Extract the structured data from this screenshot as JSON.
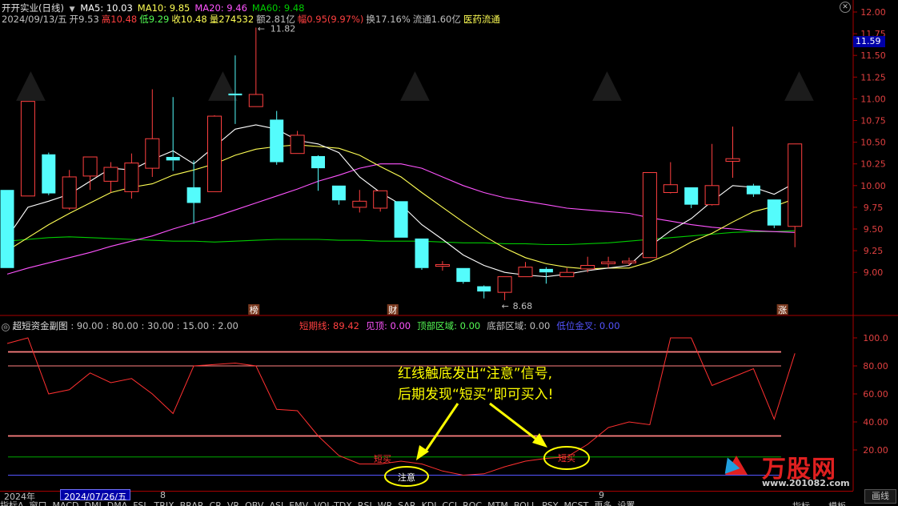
{
  "colors": {
    "background": "#000000",
    "up": "#ff4040",
    "down": "#54fcfc",
    "ma5": "#ffffff",
    "ma10": "#ffff54",
    "ma20": "#ff54ff",
    "ma60": "#00cc00",
    "axis_border": "#a80000",
    "price_tag": "#0000a8"
  },
  "title": "开开实业(日线)",
  "ma_legend": [
    {
      "label": "MA5: 10.03",
      "color": "#ffffff"
    },
    {
      "label": "MA10: 9.85",
      "color": "#ffff54"
    },
    {
      "label": "MA20: 9.46",
      "color": "#ff54ff"
    },
    {
      "label": "MA60: 9.48",
      "color": "#00cc00"
    }
  ],
  "info_row": [
    {
      "text": "2024/09/13/五",
      "color": "#c0c0c0"
    },
    {
      "text": "开9.53",
      "color": "#c0c0c0"
    },
    {
      "text": "高10.48",
      "color": "#ff4040"
    },
    {
      "text": "低9.29",
      "color": "#54fc54"
    },
    {
      "text": "收10.48",
      "color": "#ffff54"
    },
    {
      "text": "量274532",
      "color": "#ffff54"
    },
    {
      "text": "额2.81亿",
      "color": "#c0c0c0"
    },
    {
      "text": "幅0.95(9.97%)",
      "color": "#ff4040"
    },
    {
      "text": "换17.16%",
      "color": "#c0c0c0"
    },
    {
      "text": "流通1.60亿",
      "color": "#c0c0c0"
    },
    {
      "text": "医药流通",
      "color": "#ffff54"
    }
  ],
  "price_axis": {
    "ticks": [
      "12.00",
      "11.75",
      "11.50",
      "11.25",
      "11.00",
      "10.75",
      "10.50",
      "10.25",
      "10.00",
      "9.75",
      "9.50",
      "9.25",
      "9.00"
    ],
    "current_price": "11.59"
  },
  "annotations": {
    "high": "11.82",
    "low": "8.68",
    "marker_bang": "榜",
    "marker_cai": "财",
    "marker_zhang": "涨"
  },
  "candles": [
    {
      "o": 9.95,
      "c": 9.05,
      "h": 9.95,
      "l": 9.05
    },
    {
      "o": 9.88,
      "c": 10.97,
      "h": 10.97,
      "l": 9.88
    },
    {
      "o": 10.36,
      "c": 9.91,
      "h": 10.38,
      "l": 9.89
    },
    {
      "o": 9.74,
      "c": 10.1,
      "h": 10.18,
      "l": 9.72
    },
    {
      "o": 10.11,
      "c": 10.33,
      "h": 10.33,
      "l": 9.95
    },
    {
      "o": 10.05,
      "c": 10.21,
      "h": 10.27,
      "l": 9.92
    },
    {
      "o": 9.93,
      "c": 10.26,
      "h": 10.37,
      "l": 9.85
    },
    {
      "o": 10.2,
      "c": 10.54,
      "h": 11.11,
      "l": 10.1
    },
    {
      "o": 10.33,
      "c": 10.29,
      "h": 11.02,
      "l": 10.17
    },
    {
      "o": 9.98,
      "c": 9.8,
      "h": 10.29,
      "l": 9.56
    },
    {
      "o": 9.93,
      "c": 10.8,
      "h": 10.81,
      "l": 9.93
    },
    {
      "o": 11.06,
      "c": 11.04,
      "h": 11.5,
      "l": 10.71
    },
    {
      "o": 10.91,
      "c": 11.05,
      "h": 11.82,
      "l": 10.91
    },
    {
      "o": 10.76,
      "c": 10.27,
      "h": 10.86,
      "l": 10.24
    },
    {
      "o": 10.37,
      "c": 10.58,
      "h": 10.63,
      "l": 10.37
    },
    {
      "o": 10.34,
      "c": 10.2,
      "h": 10.35,
      "l": 9.94
    },
    {
      "o": 10.0,
      "c": 9.83,
      "h": 10.0,
      "l": 9.78
    },
    {
      "o": 9.75,
      "c": 9.82,
      "h": 9.95,
      "l": 9.69
    },
    {
      "o": 9.74,
      "c": 9.94,
      "h": 9.94,
      "l": 9.7
    },
    {
      "o": 9.82,
      "c": 9.4,
      "h": 9.82,
      "l": 9.4
    },
    {
      "o": 9.39,
      "c": 9.05,
      "h": 9.39,
      "l": 9.03
    },
    {
      "o": 9.07,
      "c": 9.09,
      "h": 9.13,
      "l": 9.02
    },
    {
      "o": 9.05,
      "c": 8.89,
      "h": 9.05,
      "l": 8.87
    },
    {
      "o": 8.84,
      "c": 8.78,
      "h": 8.85,
      "l": 8.7
    },
    {
      "o": 8.77,
      "c": 8.95,
      "h": 8.95,
      "l": 8.68
    },
    {
      "o": 8.95,
      "c": 9.06,
      "h": 9.12,
      "l": 8.96
    },
    {
      "o": 9.04,
      "c": 9.0,
      "h": 9.06,
      "l": 8.87
    },
    {
      "o": 8.95,
      "c": 9.0,
      "h": 9.05,
      "l": 8.95
    },
    {
      "o": 9.04,
      "c": 9.08,
      "h": 9.18,
      "l": 9.0
    },
    {
      "o": 9.1,
      "c": 9.12,
      "h": 9.18,
      "l": 9.05
    },
    {
      "o": 9.11,
      "c": 9.13,
      "h": 9.17,
      "l": 9.08
    },
    {
      "o": 9.17,
      "c": 10.15,
      "h": 10.15,
      "l": 9.17
    },
    {
      "o": 9.92,
      "c": 10.01,
      "h": 10.27,
      "l": 9.91
    },
    {
      "o": 9.98,
      "c": 9.78,
      "h": 9.98,
      "l": 9.74
    },
    {
      "o": 9.78,
      "c": 10.0,
      "h": 10.48,
      "l": 9.77
    },
    {
      "o": 10.28,
      "c": 10.31,
      "h": 10.68,
      "l": 10.09
    },
    {
      "o": 10.0,
      "c": 9.9,
      "h": 10.02,
      "l": 9.87
    },
    {
      "o": 9.84,
      "c": 9.54,
      "h": 9.84,
      "l": 9.51
    },
    {
      "o": 9.53,
      "c": 10.48,
      "h": 10.48,
      "l": 9.29
    }
  ],
  "ma_series": {
    "ma5": [
      9.4,
      9.75,
      9.82,
      9.9,
      10.05,
      10.2,
      10.18,
      10.3,
      10.4,
      10.25,
      10.45,
      10.65,
      10.7,
      10.65,
      10.52,
      10.48,
      10.38,
      10.1,
      9.92,
      9.78,
      9.55,
      9.38,
      9.2,
      9.08,
      9.0,
      8.97,
      8.95,
      8.98,
      9.02,
      9.05,
      9.08,
      9.3,
      9.48,
      9.62,
      9.82,
      10.0,
      9.98,
      9.9,
      10.03
    ],
    "ma10": [
      9.25,
      9.4,
      9.55,
      9.68,
      9.8,
      9.92,
      9.98,
      10.02,
      10.12,
      10.18,
      10.25,
      10.35,
      10.42,
      10.45,
      10.47,
      10.45,
      10.43,
      10.35,
      10.22,
      10.1,
      9.92,
      9.75,
      9.58,
      9.42,
      9.28,
      9.17,
      9.1,
      9.06,
      9.04,
      9.05,
      9.05,
      9.12,
      9.22,
      9.35,
      9.45,
      9.58,
      9.7,
      9.76,
      9.85
    ],
    "ma20": [
      8.98,
      9.05,
      9.11,
      9.17,
      9.23,
      9.3,
      9.36,
      9.42,
      9.5,
      9.57,
      9.64,
      9.72,
      9.8,
      9.88,
      9.96,
      10.05,
      10.12,
      10.2,
      10.25,
      10.25,
      10.2,
      10.1,
      10.0,
      9.92,
      9.86,
      9.82,
      9.78,
      9.74,
      9.72,
      9.7,
      9.68,
      9.63,
      9.59,
      9.55,
      9.52,
      9.5,
      9.48,
      9.47,
      9.46
    ],
    "ma60": [
      9.36,
      9.38,
      9.4,
      9.41,
      9.4,
      9.39,
      9.38,
      9.37,
      9.36,
      9.36,
      9.35,
      9.36,
      9.37,
      9.38,
      9.38,
      9.38,
      9.37,
      9.37,
      9.36,
      9.36,
      9.36,
      9.35,
      9.34,
      9.34,
      9.33,
      9.33,
      9.32,
      9.32,
      9.33,
      9.34,
      9.36,
      9.38,
      9.4,
      9.42,
      9.44,
      9.46,
      9.47,
      9.47,
      9.48
    ]
  },
  "sub_panel": {
    "title": "超短资金副图",
    "params": ": 90.00 : 80.00 : 30.00 : 15.00 : 2.00",
    "legend": [
      {
        "text": "短期线: 89.42",
        "color": "#ff4040"
      },
      {
        "text": "见顶: 0.00",
        "color": "#ff54ff"
      },
      {
        "text": "顶部区域: 0.00",
        "color": "#54fc54"
      },
      {
        "text": "底部区域: 0.00",
        "color": "#c0c0c0"
      },
      {
        "text": "低位金叉: 0.00",
        "color": "#5454ff"
      }
    ],
    "ticks": [
      "100.0",
      "80.00",
      "60.00",
      "40.00",
      "20.00"
    ],
    "levels": [
      {
        "value": 90,
        "color": "#ff8080"
      },
      {
        "value": 80,
        "color": "#ff8080"
      },
      {
        "value": 30,
        "color": "#ff8080"
      },
      {
        "value": 15,
        "color": "#00aa00"
      },
      {
        "value": 2,
        "color": "#5454ff"
      }
    ],
    "short_line": [
      96,
      100,
      60,
      63,
      75,
      68,
      71,
      60,
      46,
      80,
      81,
      82,
      80,
      49,
      48,
      30,
      16,
      10,
      10,
      12,
      10,
      5,
      2,
      3,
      8,
      12,
      14,
      15,
      24,
      36,
      40,
      38,
      100,
      100,
      66,
      72,
      78,
      42,
      89
    ],
    "callout_line1": "红线触底发出“注意”信号,",
    "callout_line2": "后期发现“短买”即可买入!",
    "label_buy1": "短买",
    "label_buy2": "短买",
    "label_attention": "注意"
  },
  "date_bar": {
    "year": "2024年",
    "cursor_date": "2024/07/26/五",
    "month_8": "8",
    "month_9": "9"
  },
  "bottom_tabs": [
    "指标A",
    "窗口",
    "MACD",
    "DMI",
    "DMA",
    "FSL",
    "TRIX",
    "BRAR",
    "CR",
    "VR",
    "OBV",
    "ASI",
    "EMV",
    "VOL-TDX",
    "RSI",
    "WR",
    "SAR",
    "KDJ",
    "CCI",
    "ROC",
    "MTM",
    "BOLL",
    "PSY",
    "MCST",
    "更多",
    "设置"
  ],
  "bottom_right": {
    "left_tab": "指标",
    "right_tab": "模板",
    "corner": "画线"
  },
  "watermark": {
    "brand": "万股网",
    "site": "www.201082.com"
  }
}
